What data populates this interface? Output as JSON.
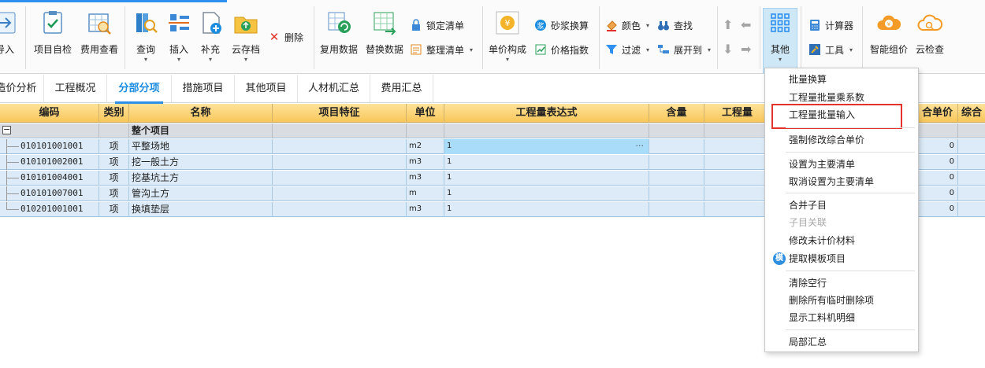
{
  "ribbon": {
    "import_label": "导入",
    "self_check_label": "项目自检",
    "fee_view_label": "费用查看",
    "query_label": "查询",
    "insert_label": "插入",
    "supplement_label": "补充",
    "cloud_save_label": "云存档",
    "delete_label": "删除",
    "reuse_data_label": "复用数据",
    "replace_data_label": "替换数据",
    "lock_list_label": "锁定清单",
    "organize_list_label": "整理清单",
    "unit_price_label": "单价构成",
    "mortar_label": "砂浆换算",
    "price_index_label": "价格指数",
    "color_label": "颜色",
    "filter_label": "过滤",
    "find_label": "查找",
    "expand_label": "展开到",
    "other_label": "其他",
    "calculator_label": "计算器",
    "tools_label": "工具",
    "smart_pricing_label": "智能组价",
    "cloud_check_label": "云检查"
  },
  "tabs": [
    {
      "label": "造价分析"
    },
    {
      "label": "工程概况"
    },
    {
      "label": "分部分项"
    },
    {
      "label": "措施项目"
    },
    {
      "label": "其他项目"
    },
    {
      "label": "人材机汇总"
    },
    {
      "label": "费用汇总"
    }
  ],
  "grid": {
    "headers": {
      "code": "编码",
      "category": "类别",
      "name": "名称",
      "feature": "项目特征",
      "unit": "单位",
      "qty_expr": "工程量表达式",
      "content": "含量",
      "quantity": "工程量",
      "composite_price": "合单价",
      "composite": "综合"
    },
    "group_row": {
      "name": "整个项目",
      "toggle": "−"
    },
    "rows": [
      {
        "code": "010101001001",
        "category": "项",
        "name": "平整场地",
        "unit": "m2",
        "expr": "1",
        "price": "0",
        "expr_more": "···"
      },
      {
        "code": "010101002001",
        "category": "项",
        "name": "挖一般土方",
        "unit": "m3",
        "expr": "1",
        "price": "0"
      },
      {
        "code": "010101004001",
        "category": "项",
        "name": "挖基坑土方",
        "unit": "m3",
        "expr": "1",
        "price": "0"
      },
      {
        "code": "010101007001",
        "category": "项",
        "name": "管沟土方",
        "unit": "m",
        "expr": "1",
        "price": "0"
      },
      {
        "code": "010201001001",
        "category": "项",
        "name": "换填垫层",
        "unit": "m3",
        "expr": "1",
        "price": "0"
      }
    ]
  },
  "menu": {
    "items": [
      {
        "label": "批量换算"
      },
      {
        "label": "工程量批量乘系数"
      },
      {
        "label": "工程量批量输入"
      },
      {
        "label": "强制修改综合单价"
      },
      {
        "label": "设置为主要清单"
      },
      {
        "label": "取消设置为主要清单"
      },
      {
        "label": "合并子目"
      },
      {
        "label": "子目关联"
      },
      {
        "label": "修改未计价材料"
      },
      {
        "label": "提取模板项目"
      },
      {
        "label": "清除空行"
      },
      {
        "label": "删除所有临时删除项"
      },
      {
        "label": "显示工料机明细"
      },
      {
        "label": "局部汇总"
      }
    ],
    "template_badge": "模"
  },
  "colors": {
    "accent": "#2d8fe8",
    "header_gold": "#f8c75b",
    "row_blue": "#dcebf7",
    "highlight_red": "#e5322d"
  }
}
